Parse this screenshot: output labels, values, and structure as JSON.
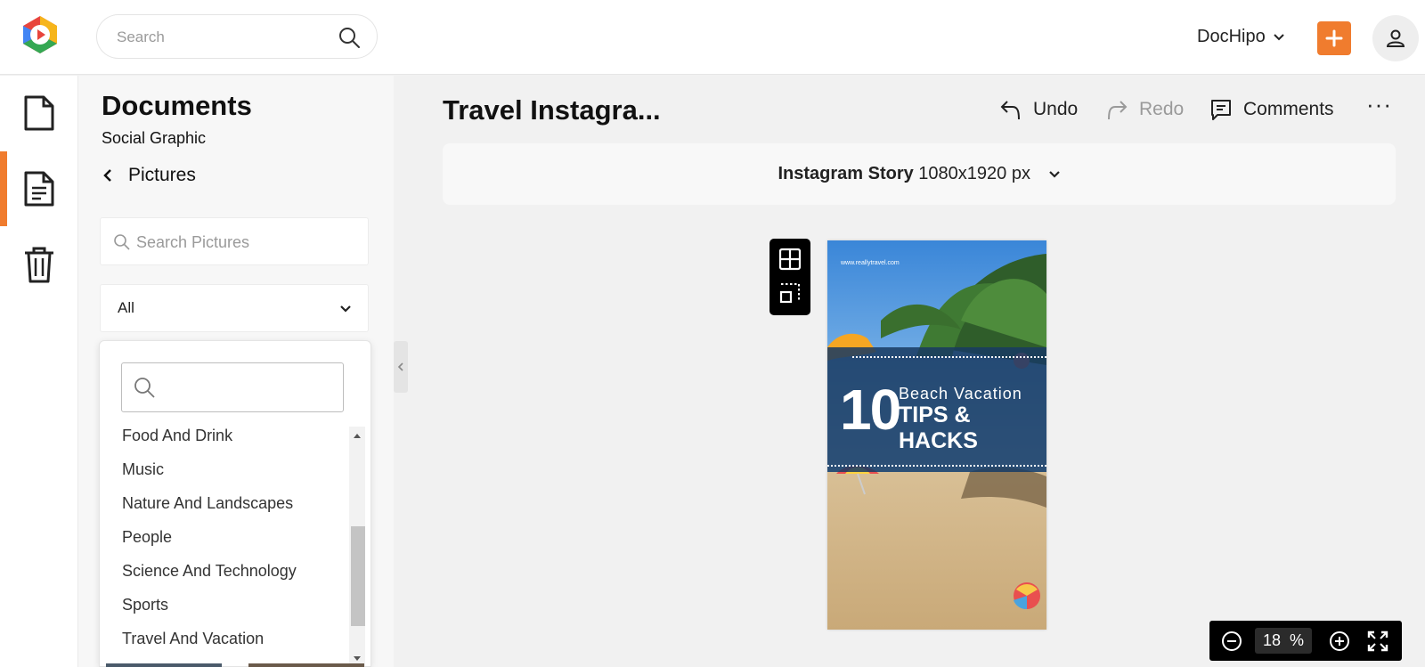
{
  "header": {
    "search_placeholder": "Search",
    "brand_label": "DocHipo",
    "accent_color": "#f07c2e"
  },
  "rail": {
    "items": [
      {
        "icon": "document-icon"
      },
      {
        "icon": "document-lines-icon",
        "active": true
      },
      {
        "icon": "trash-icon"
      }
    ]
  },
  "panel": {
    "title": "Documents",
    "subtitle": "Social Graphic",
    "back_label": "Pictures",
    "search_placeholder": "Search Pictures",
    "category_selected": "All",
    "dropdown_items": [
      "Food And Drink",
      "Music",
      "Nature And Landscapes",
      "People",
      "Science And Technology",
      "Sports",
      "Travel And Vacation"
    ]
  },
  "editor": {
    "doc_title": "Travel Instagra...",
    "undo_label": "Undo",
    "redo_label": "Redo",
    "comments_label": "Comments",
    "more_label": "···",
    "format_name": "Instagram Story",
    "format_size": "1080x1920 px"
  },
  "design": {
    "url": "www.reallyt­ravel.com",
    "number": "10",
    "line1": "Beach Vacation",
    "line2": "TIPS & HACKS"
  },
  "zoom": {
    "value": "18",
    "unit": "%"
  }
}
